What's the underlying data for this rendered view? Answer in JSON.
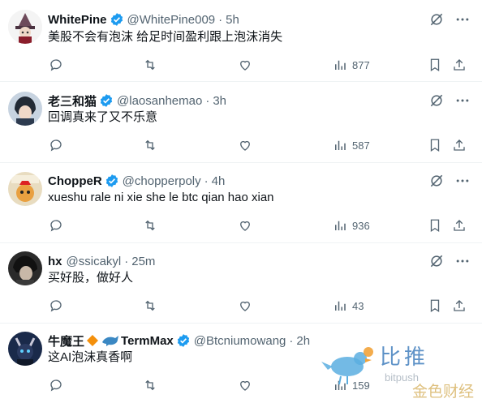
{
  "tweets": [
    {
      "name": "WhitePine",
      "handle": "@WhitePine009",
      "time": "5h",
      "text": "美股不会有泡沫 给足时间盈利跟上泡沫消失",
      "views": "877"
    },
    {
      "name": "老三和猫",
      "handle": "@laosanhemao",
      "time": "3h",
      "text": "回调真来了又不乐意",
      "views": "587"
    },
    {
      "name": "ChoppeR",
      "handle": "@chopperpoly",
      "time": "4h",
      "text": "xueshu rale ni xie she le btc qian hao xian",
      "views": "936"
    },
    {
      "name": "hx",
      "handle": "@ssicakyl",
      "time": "25m",
      "text": "买好股，做好人",
      "views": "43"
    },
    {
      "name": "牛魔王",
      "name_suffix": "TermMax",
      "handle": "@Btcniumowang",
      "time": "2h",
      "text": "这AI泡沫真香啊",
      "views": "159"
    }
  ],
  "separator": "·",
  "watermark": {
    "brand_cn": "比推",
    "brand_en": "bitpush",
    "brand_cn2": "金色财经"
  },
  "colors": {
    "verified": "#1d9bf0",
    "icon": "#536471",
    "sep": "#eff3f4"
  }
}
